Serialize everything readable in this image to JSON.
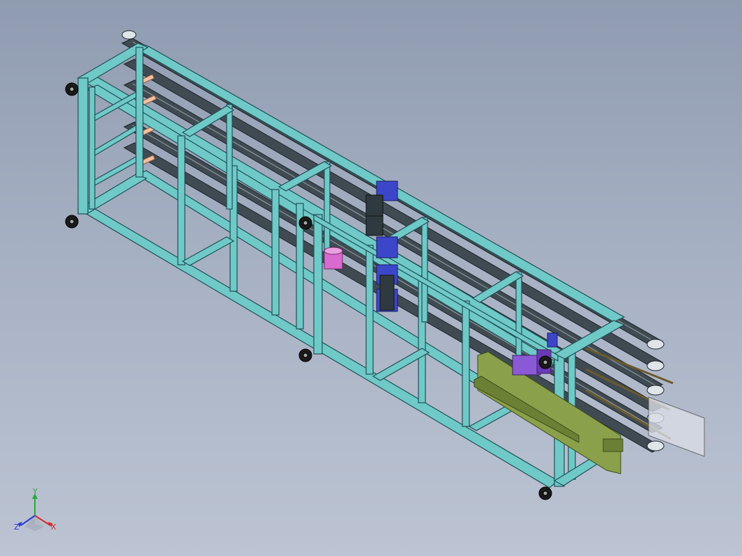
{
  "viewport": {
    "background_top": "#8f9bb0",
    "background_bottom": "#bcc4d3"
  },
  "colors": {
    "frame": "#6fc9c7",
    "frame_edge": "#1f4f55",
    "rail": "#3f4a52",
    "rail_highlight": "#9aa3a8",
    "motor_blue": "#3c46c8",
    "motor_pink": "#d86ad0",
    "motor_purple": "#8a5ad6",
    "conveyor_green": "#8aa04a",
    "wheel": "#1a1a1a",
    "pin": "#f0c0a0",
    "glass_panel": "#d9dde6"
  },
  "triad": {
    "x_label": "X",
    "y_label": "Y",
    "z_label": "Z",
    "x_color": "#d42a2a",
    "y_color": "#2aa83a",
    "z_color": "#2a3ad4"
  }
}
